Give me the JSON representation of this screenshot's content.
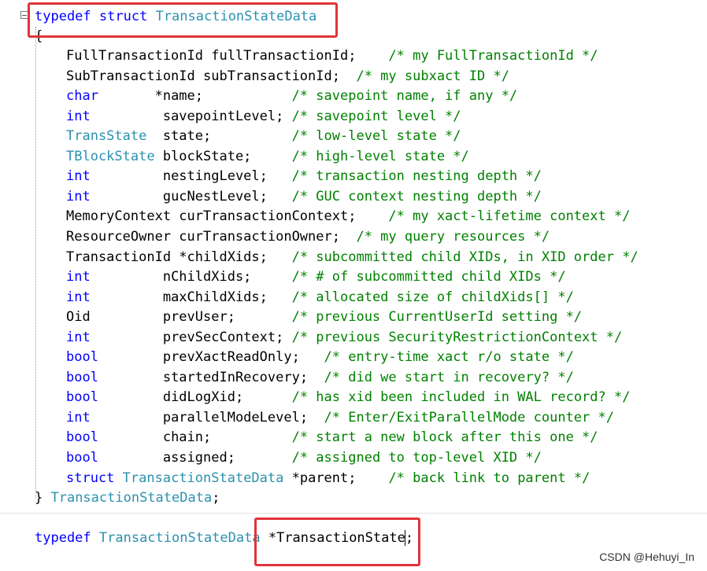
{
  "code": {
    "struct_header": [
      {
        "t": "typedef",
        "c": "kw"
      },
      {
        "t": " ",
        "c": "tx"
      },
      {
        "t": "struct",
        "c": "kw"
      },
      {
        "t": " ",
        "c": "tx"
      },
      {
        "t": "TransactionStateData",
        "c": "ty"
      }
    ],
    "open_brace": "{",
    "fields": [
      [
        {
          "t": "FullTransactionId fullTransactionId;    ",
          "c": "tx"
        },
        {
          "t": "/* my FullTransactionId */",
          "c": "cm"
        }
      ],
      [
        {
          "t": "SubTransactionId subTransactionId;  ",
          "c": "tx"
        },
        {
          "t": "/* my subxact ID */",
          "c": "cm"
        }
      ],
      [
        {
          "t": "char",
          "c": "kw"
        },
        {
          "t": "       *name;           ",
          "c": "tx"
        },
        {
          "t": "/* savepoint name, if any */",
          "c": "cm"
        }
      ],
      [
        {
          "t": "int",
          "c": "kw"
        },
        {
          "t": "         savepointLevel; ",
          "c": "tx"
        },
        {
          "t": "/* savepoint level */",
          "c": "cm"
        }
      ],
      [
        {
          "t": "TransState",
          "c": "ty"
        },
        {
          "t": "  state;          ",
          "c": "tx"
        },
        {
          "t": "/* low-level state */",
          "c": "cm"
        }
      ],
      [
        {
          "t": "TBlockState",
          "c": "ty"
        },
        {
          "t": " blockState;     ",
          "c": "tx"
        },
        {
          "t": "/* high-level state */",
          "c": "cm"
        }
      ],
      [
        {
          "t": "int",
          "c": "kw"
        },
        {
          "t": "         nestingLevel;   ",
          "c": "tx"
        },
        {
          "t": "/* transaction nesting depth */",
          "c": "cm"
        }
      ],
      [
        {
          "t": "int",
          "c": "kw"
        },
        {
          "t": "         gucNestLevel;   ",
          "c": "tx"
        },
        {
          "t": "/* GUC context nesting depth */",
          "c": "cm"
        }
      ],
      [
        {
          "t": "MemoryContext curTransactionContext;    ",
          "c": "tx"
        },
        {
          "t": "/* my xact-lifetime context */",
          "c": "cm"
        }
      ],
      [
        {
          "t": "ResourceOwner curTransactionOwner;  ",
          "c": "tx"
        },
        {
          "t": "/* my query resources */",
          "c": "cm"
        }
      ],
      [
        {
          "t": "TransactionId *childXids;   ",
          "c": "tx"
        },
        {
          "t": "/* subcommitted child XIDs, in XID order */",
          "c": "cm"
        }
      ],
      [
        {
          "t": "int",
          "c": "kw"
        },
        {
          "t": "         nChildXids;     ",
          "c": "tx"
        },
        {
          "t": "/* # of subcommitted child XIDs */",
          "c": "cm"
        }
      ],
      [
        {
          "t": "int",
          "c": "kw"
        },
        {
          "t": "         maxChildXids;   ",
          "c": "tx"
        },
        {
          "t": "/* allocated size of childXids[] */",
          "c": "cm"
        }
      ],
      [
        {
          "t": "Oid         prevUser;       ",
          "c": "tx"
        },
        {
          "t": "/* previous CurrentUserId setting */",
          "c": "cm"
        }
      ],
      [
        {
          "t": "int",
          "c": "kw"
        },
        {
          "t": "         prevSecContext; ",
          "c": "tx"
        },
        {
          "t": "/* previous SecurityRestrictionContext */",
          "c": "cm"
        }
      ],
      [
        {
          "t": "bool",
          "c": "kw"
        },
        {
          "t": "        prevXactReadOnly;   ",
          "c": "tx"
        },
        {
          "t": "/* entry-time xact r/o state */",
          "c": "cm"
        }
      ],
      [
        {
          "t": "bool",
          "c": "kw"
        },
        {
          "t": "        startedInRecovery;  ",
          "c": "tx"
        },
        {
          "t": "/* did we start in recovery? */",
          "c": "cm"
        }
      ],
      [
        {
          "t": "bool",
          "c": "kw"
        },
        {
          "t": "        didLogXid;      ",
          "c": "tx"
        },
        {
          "t": "/* has xid been included in WAL record? */",
          "c": "cm"
        }
      ],
      [
        {
          "t": "int",
          "c": "kw"
        },
        {
          "t": "         parallelModeLevel;  ",
          "c": "tx"
        },
        {
          "t": "/* Enter/ExitParallelMode counter */",
          "c": "cm"
        }
      ],
      [
        {
          "t": "bool",
          "c": "kw"
        },
        {
          "t": "        chain;          ",
          "c": "tx"
        },
        {
          "t": "/* start a new block after this one */",
          "c": "cm"
        }
      ],
      [
        {
          "t": "bool",
          "c": "kw"
        },
        {
          "t": "        assigned;       ",
          "c": "tx"
        },
        {
          "t": "/* assigned to top-level XID */",
          "c": "cm"
        }
      ],
      [
        {
          "t": "struct",
          "c": "kw"
        },
        {
          "t": " ",
          "c": "tx"
        },
        {
          "t": "TransactionStateData",
          "c": "ty"
        },
        {
          "t": " *parent;    ",
          "c": "tx"
        },
        {
          "t": "/* back link to parent */",
          "c": "cm"
        }
      ]
    ],
    "close_line": [
      {
        "t": "} ",
        "c": "tx"
      },
      {
        "t": "TransactionStateData",
        "c": "ty"
      },
      {
        "t": ";",
        "c": "tx"
      }
    ],
    "pointer_typedef": [
      {
        "t": "typedef",
        "c": "kw"
      },
      {
        "t": " ",
        "c": "tx"
      },
      {
        "t": "TransactionStateData",
        "c": "ty"
      },
      {
        "t": " *TransactionState;",
        "c": "tx"
      }
    ]
  },
  "watermark": "CSDN @Hehuyi_In",
  "colors": {
    "keyword": "#0000ff",
    "type": "#2b91af",
    "comment": "#008000",
    "highlight_box": "#e0343a"
  }
}
